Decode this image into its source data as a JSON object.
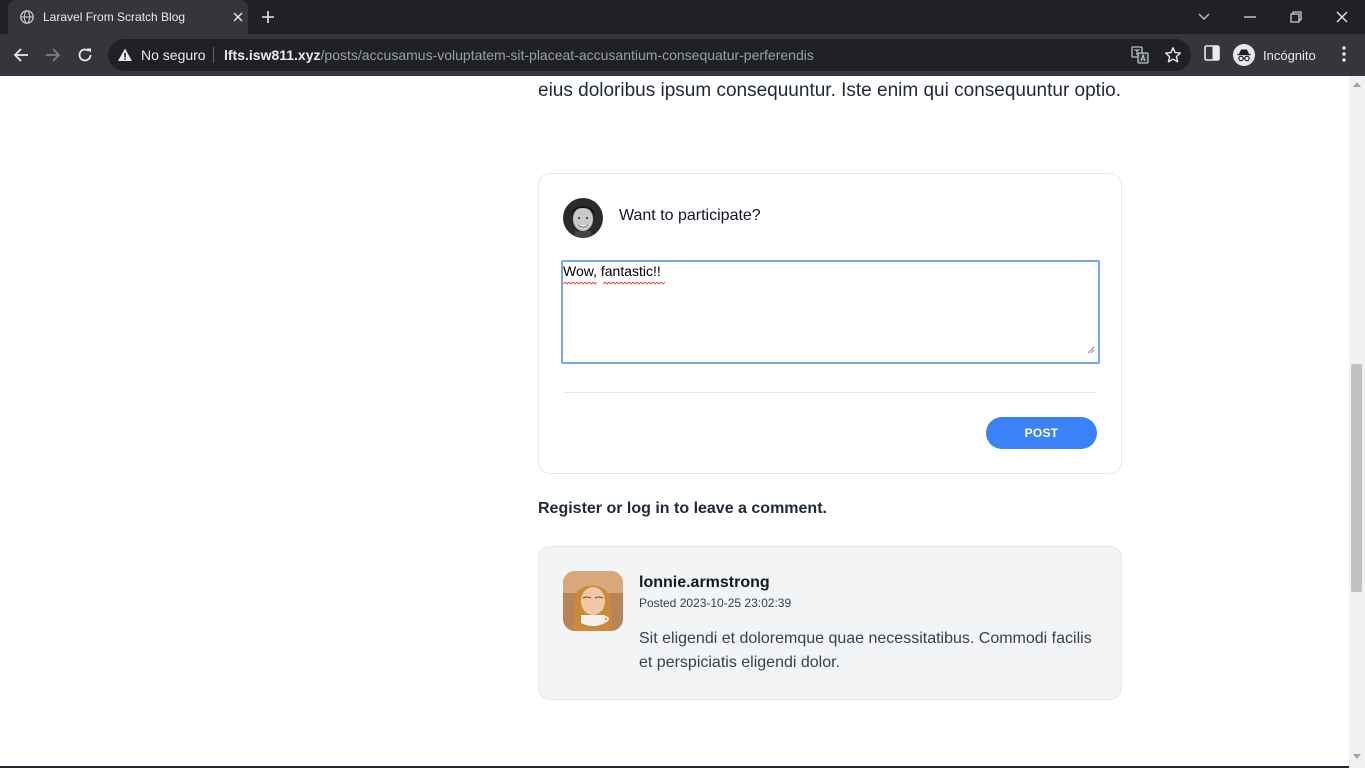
{
  "browser": {
    "tab_title": "Laravel From Scratch Blog",
    "security_label": "No seguro",
    "url_host": "lfts.isw811.xyz",
    "url_path": "/posts/accusamus-voluptatem-sit-placeat-accusantium-consequatur-perferendis",
    "profile_label": "Incógnito"
  },
  "post": {
    "body_tail": "eius doloribus ipsum consequuntur. Iste enim qui consequuntur optio."
  },
  "comment_form": {
    "heading": "Want to participate?",
    "textarea_value": "Wow, fantastic!!",
    "submit_label": "POST"
  },
  "register_prompt": "Register or log in to leave a comment.",
  "comments": [
    {
      "author": "lonnie.armstrong",
      "posted": "Posted 2023-10-25 23:02:39",
      "body": "Sit eligendi et doloremque quae necessitatibus. Commodi facilis et perspiciatis eligendi dolor."
    }
  ],
  "colors": {
    "accent": "#3b82f6",
    "card_bg": "#f3f4f6",
    "chrome_dark": "#202124",
    "chrome_toolbar": "#35363a"
  }
}
